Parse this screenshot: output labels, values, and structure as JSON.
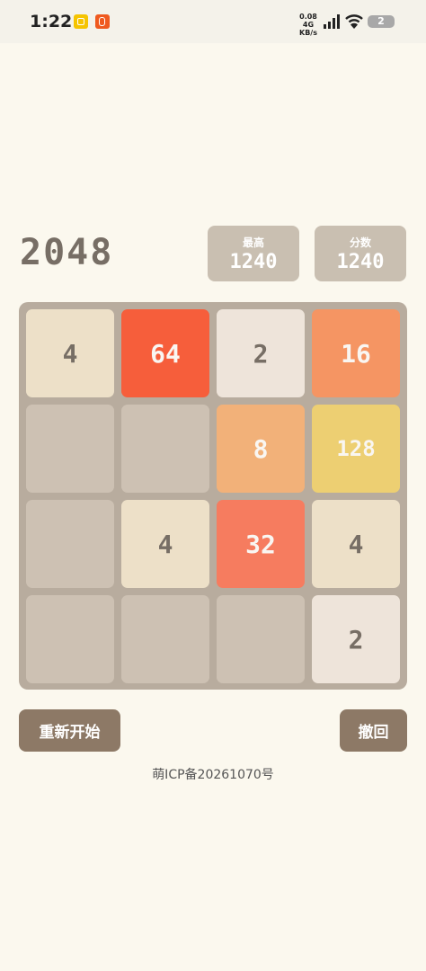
{
  "status_bar": {
    "time": "1:22",
    "net_speed": "0.08",
    "net_unit": "KB/s",
    "net_type": "4G",
    "battery": "2",
    "icons": [
      "app-yellow-icon",
      "app-orange-icon",
      "signal-icon",
      "wifi-icon",
      "battery-icon"
    ]
  },
  "header": {
    "title": "2048",
    "best_label": "最高",
    "best_value": "1240",
    "score_label": "分数",
    "score_value": "1240"
  },
  "board": {
    "grid": [
      [
        4,
        64,
        2,
        16
      ],
      [
        0,
        0,
        8,
        128
      ],
      [
        0,
        4,
        32,
        4
      ],
      [
        0,
        0,
        0,
        2
      ]
    ],
    "tile_colors": {
      "0": {
        "bg": "#cdc1b3",
        "fg": "#776e65"
      },
      "2": {
        "bg": "#eee4da",
        "fg": "#776e65"
      },
      "4": {
        "bg": "#ede0c8",
        "fg": "#776e65"
      },
      "8": {
        "bg": "#f2b179",
        "fg": "#f9f6f2"
      },
      "16": {
        "bg": "#f59563",
        "fg": "#f9f6f2"
      },
      "32": {
        "bg": "#f67c5f",
        "fg": "#f9f6f2"
      },
      "64": {
        "bg": "#f65e3b",
        "fg": "#f9f6f2"
      },
      "128": {
        "bg": "#edcf72",
        "fg": "#f9f6f2"
      }
    }
  },
  "controls": {
    "restart_label": "重新开始",
    "undo_label": "撤回"
  },
  "footer": {
    "icp": "萌ICP备20261070号"
  }
}
